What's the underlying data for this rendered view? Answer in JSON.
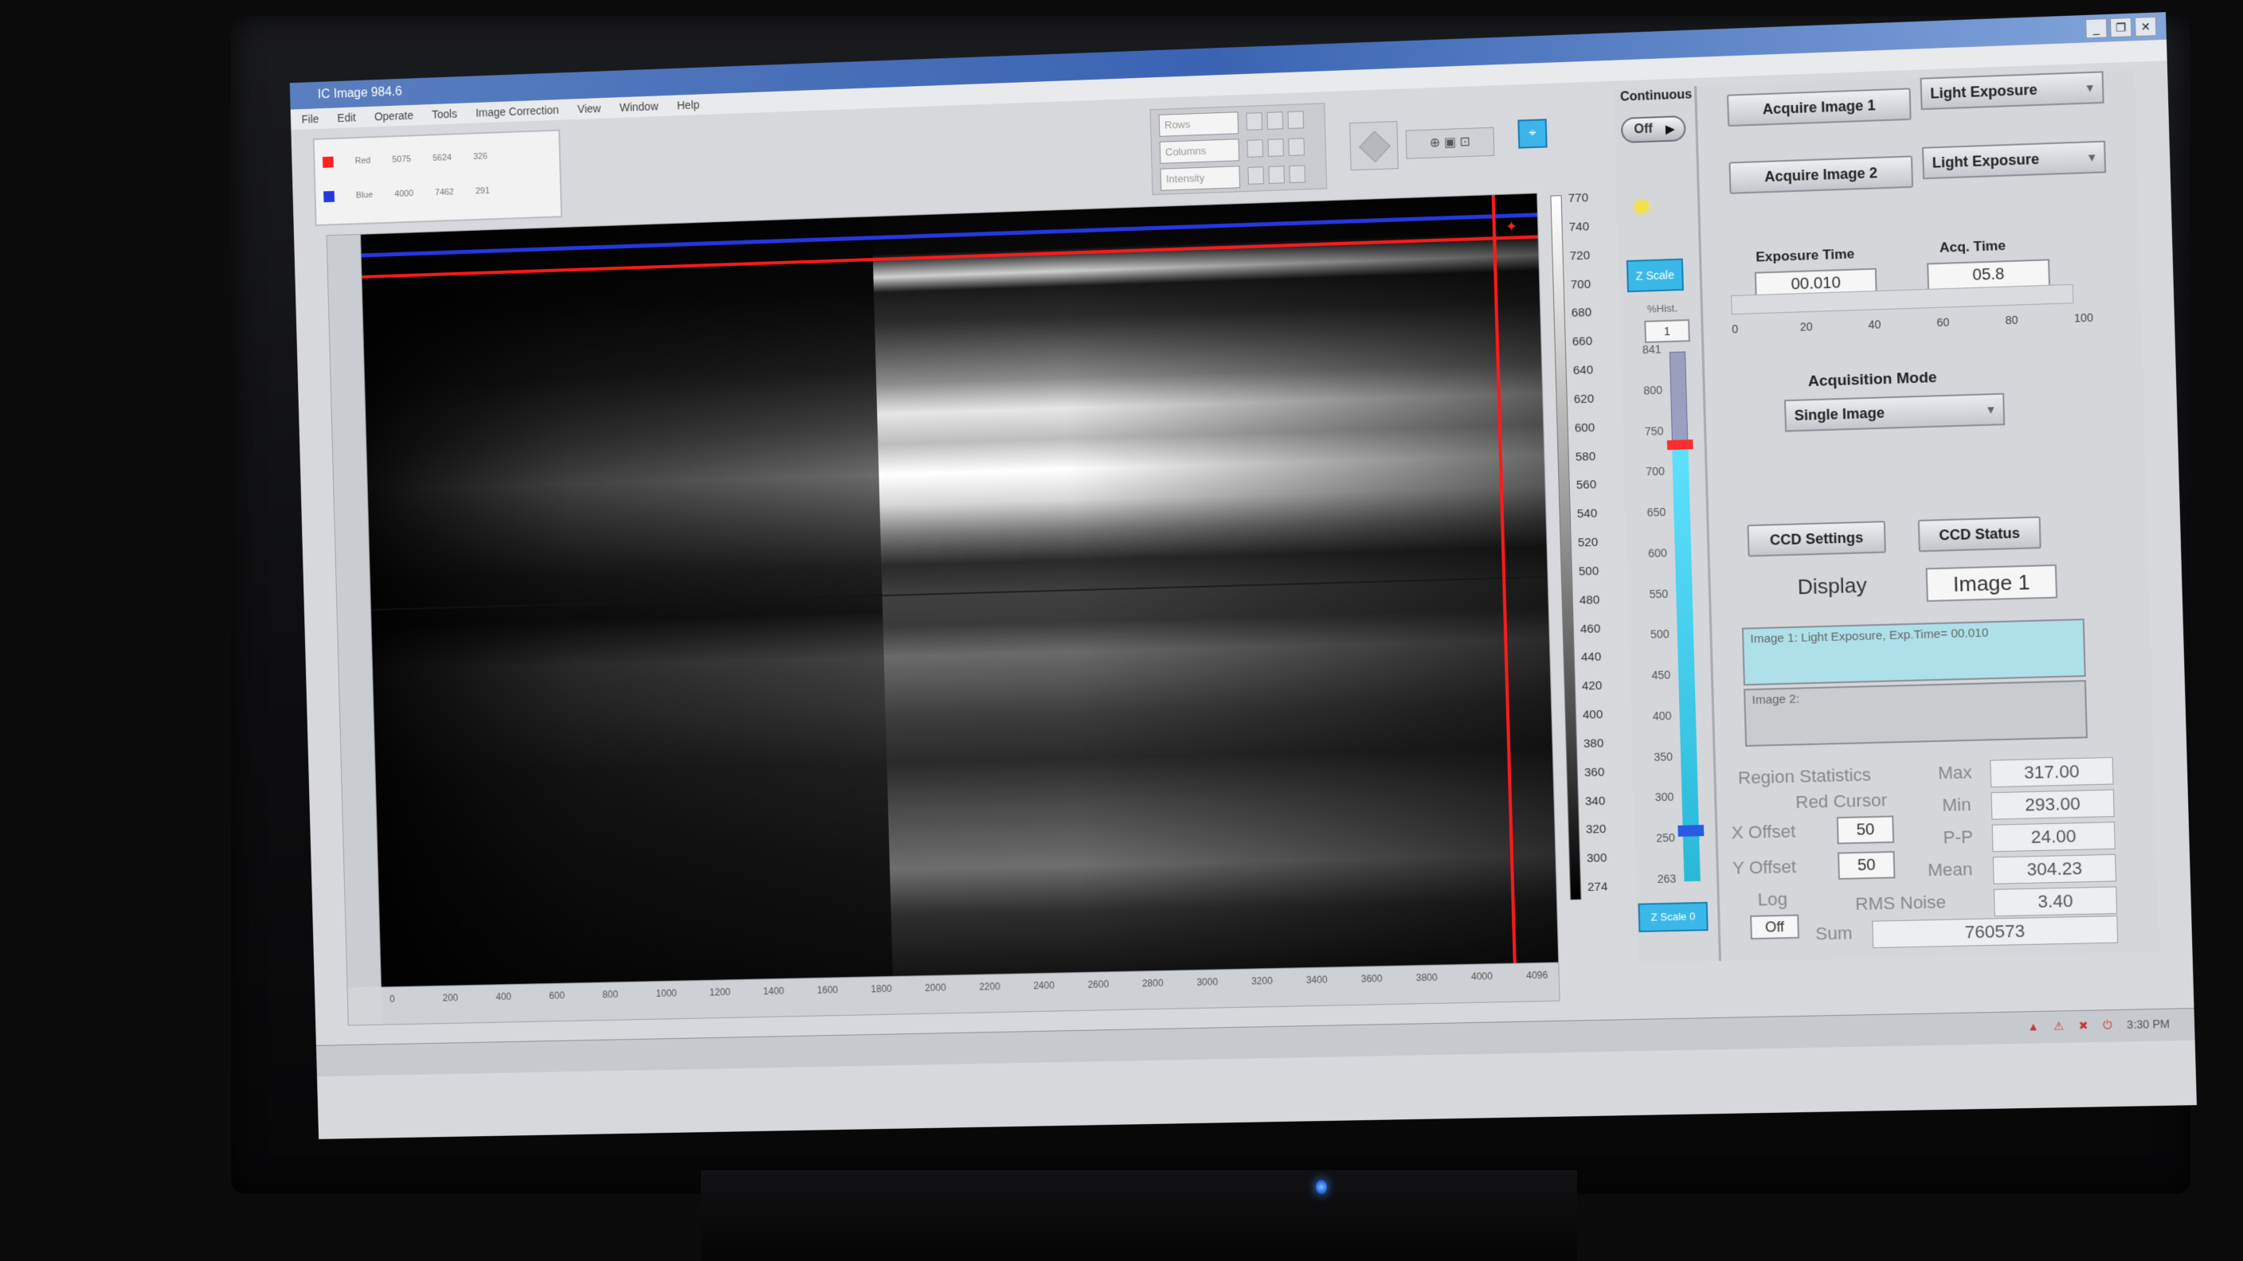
{
  "window": {
    "title": "IC Image 984.6",
    "controls": [
      "_",
      "❐",
      "✕"
    ]
  },
  "menu": [
    "File",
    "Edit",
    "Operate",
    "Tools",
    "Image Correction",
    "View",
    "Window",
    "Help"
  ],
  "cursor_legend": {
    "rows": [
      {
        "swatch": "#ff2020",
        "name": "Red",
        "col1": "5075",
        "col2": "5624",
        "col3": "326"
      },
      {
        "swatch": "#2438e0",
        "name": "Blue",
        "col1": "4000",
        "col2": "7462",
        "col3": "291"
      }
    ]
  },
  "rci": {
    "rows_placeholder": "Rows",
    "columns_placeholder": "Columns",
    "intensity_placeholder": "Intensity"
  },
  "image": {
    "x_ticks": [
      "0",
      "200",
      "400",
      "600",
      "800",
      "1000",
      "1200",
      "1400",
      "1600",
      "1800",
      "2000",
      "2200",
      "2400",
      "2600",
      "2800",
      "3000",
      "3200",
      "3400",
      "3600",
      "3800",
      "4000",
      "4096"
    ],
    "colorbar_labels": [
      "770",
      "740",
      "720",
      "700",
      "680",
      "660",
      "640",
      "620",
      "600",
      "580",
      "560",
      "540",
      "520",
      "500",
      "480",
      "460",
      "440",
      "420",
      "400",
      "380",
      "360",
      "340",
      "320",
      "300",
      "274"
    ]
  },
  "controls": {
    "continuous_label": "Continuous",
    "continuous_toggle": "Off",
    "acquire1": "Acquire Image 1",
    "acquire2": "Acquire Image 2",
    "exposure_mode1": "Light Exposure",
    "exposure_mode2": "Light Exposure",
    "zscale_btn": "Z Scale",
    "hist_label": "%Hist.",
    "hist_value": "1",
    "zscale_labels": [
      "841",
      "800",
      "750",
      "700",
      "650",
      "600",
      "550",
      "500",
      "450",
      "400",
      "350",
      "300",
      "250",
      "263"
    ],
    "zscale0_btn": "Z Scale 0",
    "exposure_time_label": "Exposure Time",
    "exposure_time_value": "00.010",
    "acq_time_label": "Acq. Time",
    "acq_time_value": "05.8",
    "progress_ticks": [
      "0",
      "20",
      "40",
      "60",
      "80",
      "100"
    ],
    "acq_mode_label": "Acquisition Mode",
    "acq_mode_value": "Single Image",
    "ccd_settings": "CCD Settings",
    "ccd_status": "CCD Status",
    "display_label": "Display",
    "display_value": "Image 1",
    "image1_info": "Image 1: Light Exposure, Exp.Time= 00.010",
    "image2_info": "Image 2:"
  },
  "stats": {
    "region_label": "Region Statistics",
    "cursor_label": "Red Cursor",
    "x_offset_label": "X Offset",
    "x_offset_value": "50",
    "y_offset_label": "Y Offset",
    "y_offset_value": "50",
    "log_label": "Log",
    "log_value": "Off",
    "max_label": "Max",
    "max_value": "317.00",
    "min_label": "Min",
    "min_value": "293.00",
    "pp_label": "P-P",
    "pp_value": "24.00",
    "mean_label": "Mean",
    "mean_value": "304.23",
    "rms_label": "RMS Noise",
    "rms_value": "3.40",
    "sum_label": "Sum",
    "sum_value": "760573"
  },
  "taskbar": {
    "clock": "3:30 PM"
  }
}
